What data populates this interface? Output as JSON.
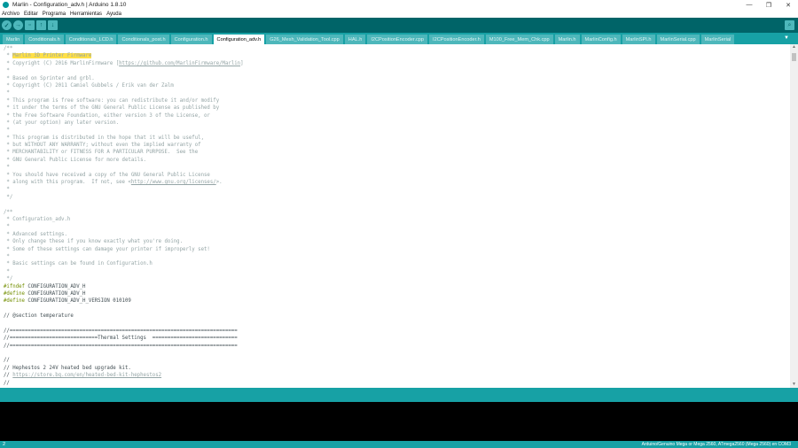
{
  "window": {
    "title": "Marlin - Configuration_adv.h | Arduino 1.8.10",
    "controls": [
      "—",
      "❐",
      "✕"
    ]
  },
  "menu": [
    "Archivo",
    "Editar",
    "Programa",
    "Herramientas",
    "Ayuda"
  ],
  "toolbar": {
    "buttons": [
      "verify-icon",
      "upload-icon",
      "new-icon",
      "open-icon",
      "save-icon"
    ],
    "serial_monitor": "serial-monitor-icon"
  },
  "tabs": [
    {
      "label": "Marlin",
      "active": false
    },
    {
      "label": "Conditionals.h",
      "active": false
    },
    {
      "label": "Conditionals_LCD.h",
      "active": false
    },
    {
      "label": "Conditionals_post.h",
      "active": false
    },
    {
      "label": "Configuration.h",
      "active": false
    },
    {
      "label": "Configuration_adv.h",
      "active": true
    },
    {
      "label": "G26_Mesh_Validation_Tool.cpp",
      "active": false
    },
    {
      "label": "HAL.h",
      "active": false
    },
    {
      "label": "I2CPositionEncoder.cpp",
      "active": false
    },
    {
      "label": "I2CPositionEncoder.h",
      "active": false
    },
    {
      "label": "M100_Free_Mem_Chk.cpp",
      "active": false
    },
    {
      "label": "Marlin.h",
      "active": false
    },
    {
      "label": "MarlinConfig.h",
      "active": false
    },
    {
      "label": "MarlinSPI.h",
      "active": false
    },
    {
      "label": "MarlinSerial.cpp",
      "active": false
    },
    {
      "label": "MarlinSerial",
      "active": false
    }
  ],
  "tab_menu_label": "▼",
  "code": [
    [
      {
        "t": "/**",
        "c": "cm"
      }
    ],
    [
      {
        "t": " * ",
        "c": "cm"
      },
      {
        "t": "Marlin 3D Printer Firmware",
        "c": "hl"
      }
    ],
    [
      {
        "t": " * Copyright (C) 2016 MarlinFirmware [",
        "c": "cm"
      },
      {
        "t": "https://github.com/MarlinFirmware/Marlin",
        "c": "link"
      },
      {
        "t": "]",
        "c": "cm"
      }
    ],
    [
      {
        "t": " *",
        "c": "cm"
      }
    ],
    [
      {
        "t": " * Based on Sprinter and grbl.",
        "c": "cm"
      }
    ],
    [
      {
        "t": " * Copyright (C) 2011 Camiel Gubbels / Erik van der Zalm",
        "c": "cm"
      }
    ],
    [
      {
        "t": " *",
        "c": "cm"
      }
    ],
    [
      {
        "t": " * This program is free software: you can redistribute it and/or modify",
        "c": "cm"
      }
    ],
    [
      {
        "t": " * it under the terms of the GNU General Public License as published by",
        "c": "cm"
      }
    ],
    [
      {
        "t": " * the Free Software Foundation, either version 3 of the License, or",
        "c": "cm"
      }
    ],
    [
      {
        "t": " * (at your option) any later version.",
        "c": "cm"
      }
    ],
    [
      {
        "t": " *",
        "c": "cm"
      }
    ],
    [
      {
        "t": " * This program is distributed in the hope that it will be useful,",
        "c": "cm"
      }
    ],
    [
      {
        "t": " * but WITHOUT ANY WARRANTY; without even the implied warranty of",
        "c": "cm"
      }
    ],
    [
      {
        "t": " * MERCHANTABILITY or FITNESS FOR A PARTICULAR PURPOSE.  See the",
        "c": "cm"
      }
    ],
    [
      {
        "t": " * GNU General Public License for more details.",
        "c": "cm"
      }
    ],
    [
      {
        "t": " *",
        "c": "cm"
      }
    ],
    [
      {
        "t": " * You should have received a copy of the GNU General Public License",
        "c": "cm"
      }
    ],
    [
      {
        "t": " * along with this program.  If not, see <",
        "c": "cm"
      },
      {
        "t": "http://www.gnu.org/licenses/",
        "c": "link"
      },
      {
        "t": ">.",
        "c": "cm"
      }
    ],
    [
      {
        "t": " *",
        "c": "cm"
      }
    ],
    [
      {
        "t": " */",
        "c": "cm"
      }
    ],
    [
      {
        "t": "",
        "c": "kw"
      }
    ],
    [
      {
        "t": "/**",
        "c": "cm"
      }
    ],
    [
      {
        "t": " * Configuration_adv.h",
        "c": "cm"
      }
    ],
    [
      {
        "t": " *",
        "c": "cm"
      }
    ],
    [
      {
        "t": " * Advanced settings.",
        "c": "cm"
      }
    ],
    [
      {
        "t": " * Only change these if you know exactly what you're doing.",
        "c": "cm"
      }
    ],
    [
      {
        "t": " * Some of these settings can damage your printer if improperly set!",
        "c": "cm"
      }
    ],
    [
      {
        "t": " *",
        "c": "cm"
      }
    ],
    [
      {
        "t": " * Basic settings can be found in Configuration.h",
        "c": "cm"
      }
    ],
    [
      {
        "t": " *",
        "c": "cm"
      }
    ],
    [
      {
        "t": " */",
        "c": "cm"
      }
    ],
    [
      {
        "t": "#ifndef",
        "c": "pp"
      },
      {
        "t": " CONFIGURATION_ADV_H",
        "c": "kw"
      }
    ],
    [
      {
        "t": "#define",
        "c": "pp"
      },
      {
        "t": " CONFIGURATION_ADV_H",
        "c": "kw"
      }
    ],
    [
      {
        "t": "#define",
        "c": "pp"
      },
      {
        "t": " CONFIGURATION_ADV_H_VERSION 010109",
        "c": "kw"
      }
    ],
    [
      {
        "t": "",
        "c": "kw"
      }
    ],
    [
      {
        "t": "// @section temperature",
        "c": "kw"
      }
    ],
    [
      {
        "t": "",
        "c": "kw"
      }
    ],
    [
      {
        "t": "//===========================================================================",
        "c": "kw"
      }
    ],
    [
      {
        "t": "//=============================Thermal Settings  ============================",
        "c": "kw"
      }
    ],
    [
      {
        "t": "//===========================================================================",
        "c": "kw"
      }
    ],
    [
      {
        "t": "",
        "c": "kw"
      }
    ],
    [
      {
        "t": "//",
        "c": "kw"
      }
    ],
    [
      {
        "t": "// Hephestos 2 24V heated bed upgrade kit.",
        "c": "kw"
      }
    ],
    [
      {
        "t": "// ",
        "c": "kw"
      },
      {
        "t": "https://store.bq.com/en/heated-bed-kit-hephestos2",
        "c": "link"
      }
    ],
    [
      {
        "t": "//",
        "c": "kw"
      }
    ]
  ],
  "status": {
    "line_number": "2",
    "board": "Arduino/Genuino Mega or Mega 2560, ATmega2560 (Mega 2560) en COM3"
  }
}
